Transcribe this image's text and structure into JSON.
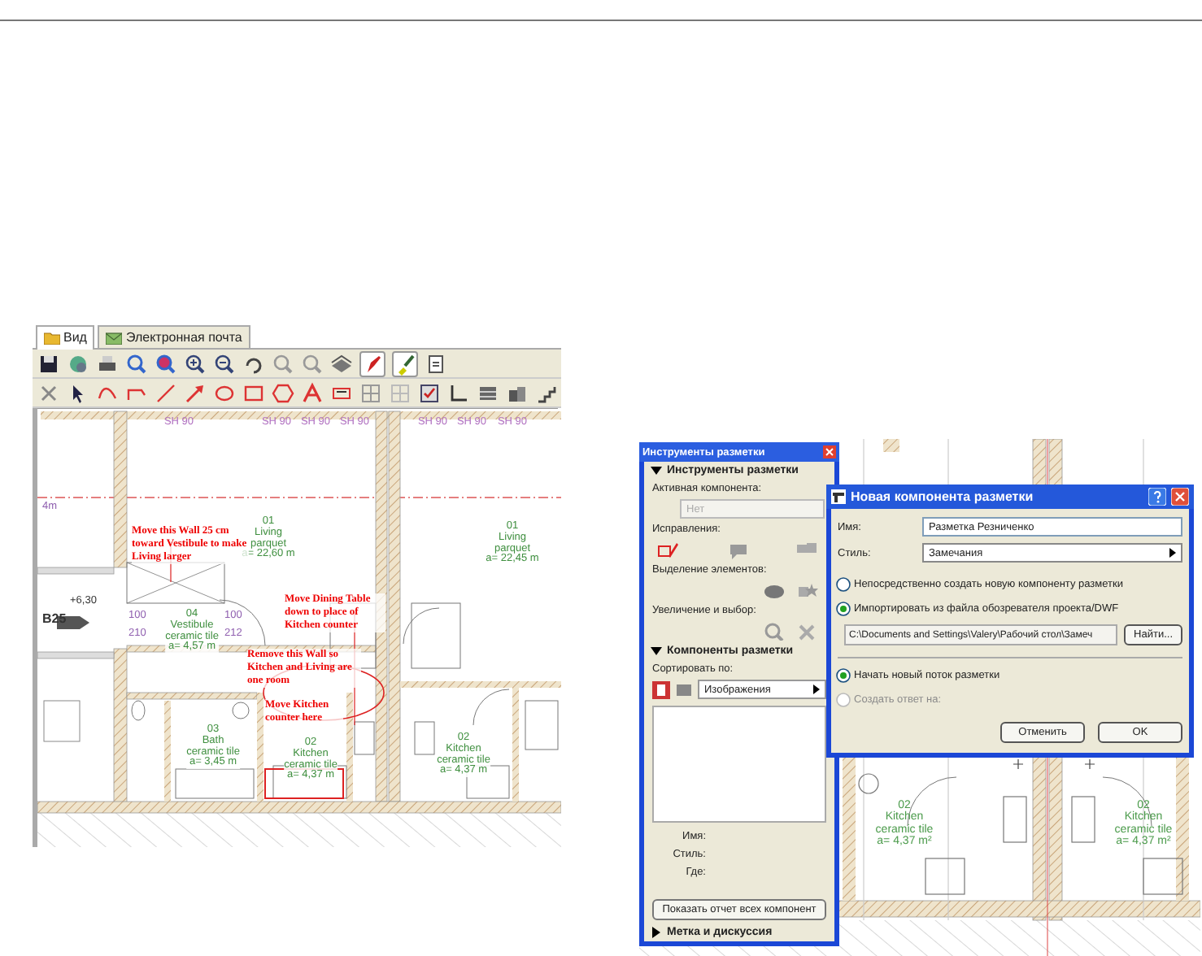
{
  "left_window": {
    "tabs": [
      {
        "label": "Вид",
        "selected": true
      },
      {
        "label": "Электронная почта",
        "selected": false
      }
    ],
    "plan": {
      "door_marks": [
        "SH 90",
        "SH 90",
        "SH 90",
        "SH 90",
        "SH 90",
        "SH 90",
        "SH 90"
      ],
      "level_mark": "4m",
      "rooms": [
        {
          "number": "01",
          "name": "Living",
          "finish": "parquet",
          "area": "a= 22,60 m"
        },
        {
          "number": "01",
          "name": "Living",
          "finish": "parquet",
          "area": "a= 22,45 m"
        },
        {
          "number": "04",
          "name": "Vestibule",
          "finish": "ceramic tile",
          "area": "a= 4,57 m"
        },
        {
          "number": "03",
          "name": "Bath",
          "finish": "ceramic tile",
          "area": "a= 3,45 m"
        },
        {
          "number": "02",
          "name": "Kitchen",
          "finish": "ceramic tile",
          "area": "a= 4,37 m"
        },
        {
          "number": "02",
          "name": "Kitchen",
          "finish": "ceramic tile",
          "area": "a= 4,37 m"
        }
      ],
      "elevation": {
        "value": "+6,30",
        "label": "B25"
      },
      "door_sizes": [
        "100",
        "210",
        "100",
        "212"
      ],
      "notes": [
        "Move this Wall 25 cm toward Vestibule to make Living larger",
        "Move Dining Table down to place of Kitchen counter",
        "Remove this Wall so Kitchen and Living are one room",
        "Move Kitchen counter here"
      ]
    }
  },
  "right_window": {
    "plan": {
      "rooms": [
        {
          "number": "02",
          "name": "Kitchen",
          "finish": "ceramic tile",
          "area": "a= 4,37 m²"
        },
        {
          "number": "02",
          "name": "Kitchen",
          "finish": "ceramic tile",
          "area": "a= 4,37 m²"
        }
      ]
    },
    "palette": {
      "title": "Инструменты разметки",
      "tools_section": {
        "title": "Инструменты разметки",
        "expanded": true
      },
      "active_label": "Активная компонента:",
      "active_value": {
        "value": "Нет",
        "disabled": true
      },
      "groups": [
        "Исправления:",
        "Выделение элементов:",
        "Увеличение и выбор:"
      ],
      "components_section": {
        "title": "Компоненты разметки",
        "expanded": true
      },
      "sort_label": "Сортировать по:",
      "sort_value": "Изображения",
      "info_labels": [
        "Имя:",
        "Стиль:",
        "Где:"
      ],
      "report_button": "Показать отчет всех компонент",
      "discussion_section": {
        "title": "Метка и дискуссия",
        "expanded": false
      }
    },
    "dialog": {
      "title": "Новая компонента разметки",
      "fields": [
        {
          "label": "Имя:",
          "kind": "text",
          "value": "Разметка Резниченко"
        },
        {
          "label": "Стиль:",
          "kind": "dropdown",
          "value": "Замечания"
        }
      ],
      "source_options": [
        {
          "label": "Непосредственно создать новую компоненту разметки",
          "selected": false
        },
        {
          "label": "Импортировать из файла обозревателя проекта/DWF",
          "selected": true
        }
      ],
      "path": "C:\\Documents and Settings\\Valery\\Рабочий стол\\Замеч",
      "browse_button": "Найти...",
      "thread_options": [
        {
          "label": "Начать новый поток разметки",
          "selected": true,
          "disabled": false
        },
        {
          "label": "Создать ответ на:",
          "selected": false,
          "disabled": true
        }
      ],
      "buttons": [
        "Отменить",
        "OK"
      ]
    }
  }
}
